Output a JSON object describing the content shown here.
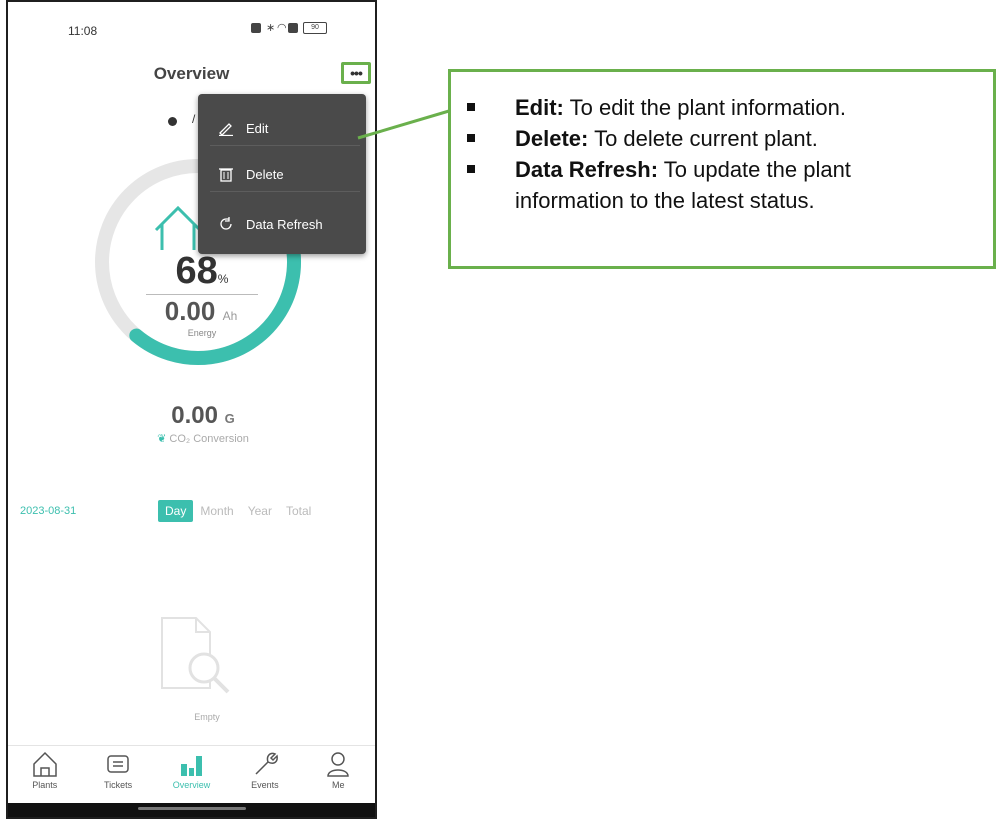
{
  "status_bar": {
    "time": "11:08",
    "battery": "90"
  },
  "header": {
    "title": "Overview",
    "more_label": "•••"
  },
  "plant": {
    "name_partial": "/"
  },
  "gauge": {
    "percent": "68",
    "percent_unit": "%",
    "level_fraction": 0.68
  },
  "energy": {
    "value": "0.00",
    "unit": "Ah",
    "label": "Energy"
  },
  "co2": {
    "value": "0.00",
    "unit": "G",
    "label": "CO₂ Conversion"
  },
  "date_filter": {
    "date": "2023-08-31",
    "tabs": [
      "Day",
      "Month",
      "Year",
      "Total"
    ],
    "selected": "Day"
  },
  "empty_state": {
    "label": "Empty"
  },
  "bottom_nav": {
    "items": [
      "Plants",
      "Tickets",
      "Overview",
      "Events",
      "Me"
    ],
    "selected": "Overview"
  },
  "menu": {
    "items": [
      "Edit",
      "Delete",
      "Data Refresh"
    ]
  },
  "callout": {
    "items": [
      {
        "term": "Edit:",
        "desc": " To edit the plant information."
      },
      {
        "term": "Delete:",
        "desc": " To delete current plant."
      },
      {
        "term": "Data Refresh:",
        "desc": " To update the plant"
      }
    ],
    "continuation": "information to the latest status."
  },
  "colors": {
    "accent": "#3cbfae",
    "highlight": "#6ab04c",
    "menu_bg": "#4a4a4a"
  }
}
